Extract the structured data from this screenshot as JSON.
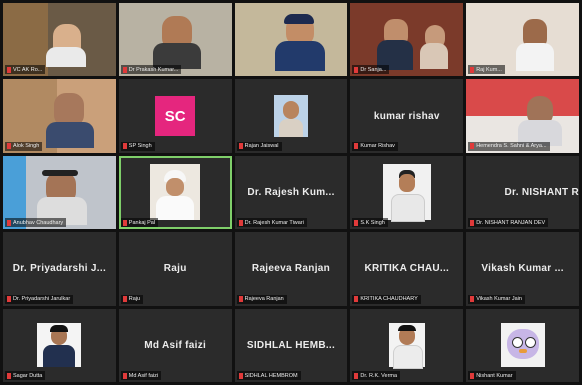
{
  "tiles": [
    {
      "id": "t1",
      "kind": "video",
      "label": "VC AK Ro..."
    },
    {
      "id": "t2",
      "kind": "video",
      "label": "Dr Prakash Kumar..."
    },
    {
      "id": "t3",
      "kind": "video",
      "label": ""
    },
    {
      "id": "t4",
      "kind": "video",
      "label": "Dr Sanja..."
    },
    {
      "id": "t5",
      "kind": "video",
      "label": "Raj Kum..."
    },
    {
      "id": "t6",
      "kind": "video",
      "label": "Alok Singh"
    },
    {
      "id": "t7",
      "kind": "avatar",
      "label": "SP Singh",
      "avatar_text": "SC",
      "avatar_color": "#e5267e"
    },
    {
      "id": "t8",
      "kind": "photo",
      "label": "Rajan Jaiswal"
    },
    {
      "id": "t9",
      "kind": "name",
      "name": "kumar rishav",
      "label": "Kumar Rishav"
    },
    {
      "id": "t10",
      "kind": "video",
      "label": "Hemendra S. Sahni & Arya..."
    },
    {
      "id": "t11",
      "kind": "video",
      "label": "Anubhav Chaudhary"
    },
    {
      "id": "t12",
      "kind": "video",
      "label": "Pankaj Pal",
      "active": true
    },
    {
      "id": "t13",
      "kind": "name",
      "name": "Dr. Rajesh Kum...",
      "label": "Dr. Rajesh Kumar Tiwari"
    },
    {
      "id": "t14",
      "kind": "photo",
      "label": "S.K Singh"
    },
    {
      "id": "t15",
      "kind": "name",
      "name": "Dr. NISHANT R",
      "label": "Dr. NISHANT RANJAN DEV"
    },
    {
      "id": "t16",
      "kind": "name",
      "name": "Dr. Priyadarshi J...",
      "label": "Dr. Priyadarshi Jarulkar"
    },
    {
      "id": "t17",
      "kind": "name",
      "name": "Raju",
      "label": "Raju"
    },
    {
      "id": "t18",
      "kind": "name",
      "name": "Rajeeva Ranjan",
      "label": "Rajeeva Ranjan"
    },
    {
      "id": "t19",
      "kind": "name",
      "name": "KRITIKA CHAU...",
      "label": "KRITIKA CHAUDHARY"
    },
    {
      "id": "t20",
      "kind": "name",
      "name": "Vikash Kumar ...",
      "label": "Vikash Kumar Jain"
    },
    {
      "id": "t21",
      "kind": "photo",
      "label": "Sagar Dutta"
    },
    {
      "id": "t22",
      "kind": "name",
      "name": "Md Asif faizi",
      "label": "Md Asif faizi"
    },
    {
      "id": "t23",
      "kind": "name",
      "name": "SIDHLAL HEMB...",
      "label": "SIDHLAL HEMBROM"
    },
    {
      "id": "t24",
      "kind": "photo",
      "label": "Dr. R.K. Verma"
    },
    {
      "id": "t25",
      "kind": "photo",
      "label": "Nishant Kumar"
    }
  ]
}
